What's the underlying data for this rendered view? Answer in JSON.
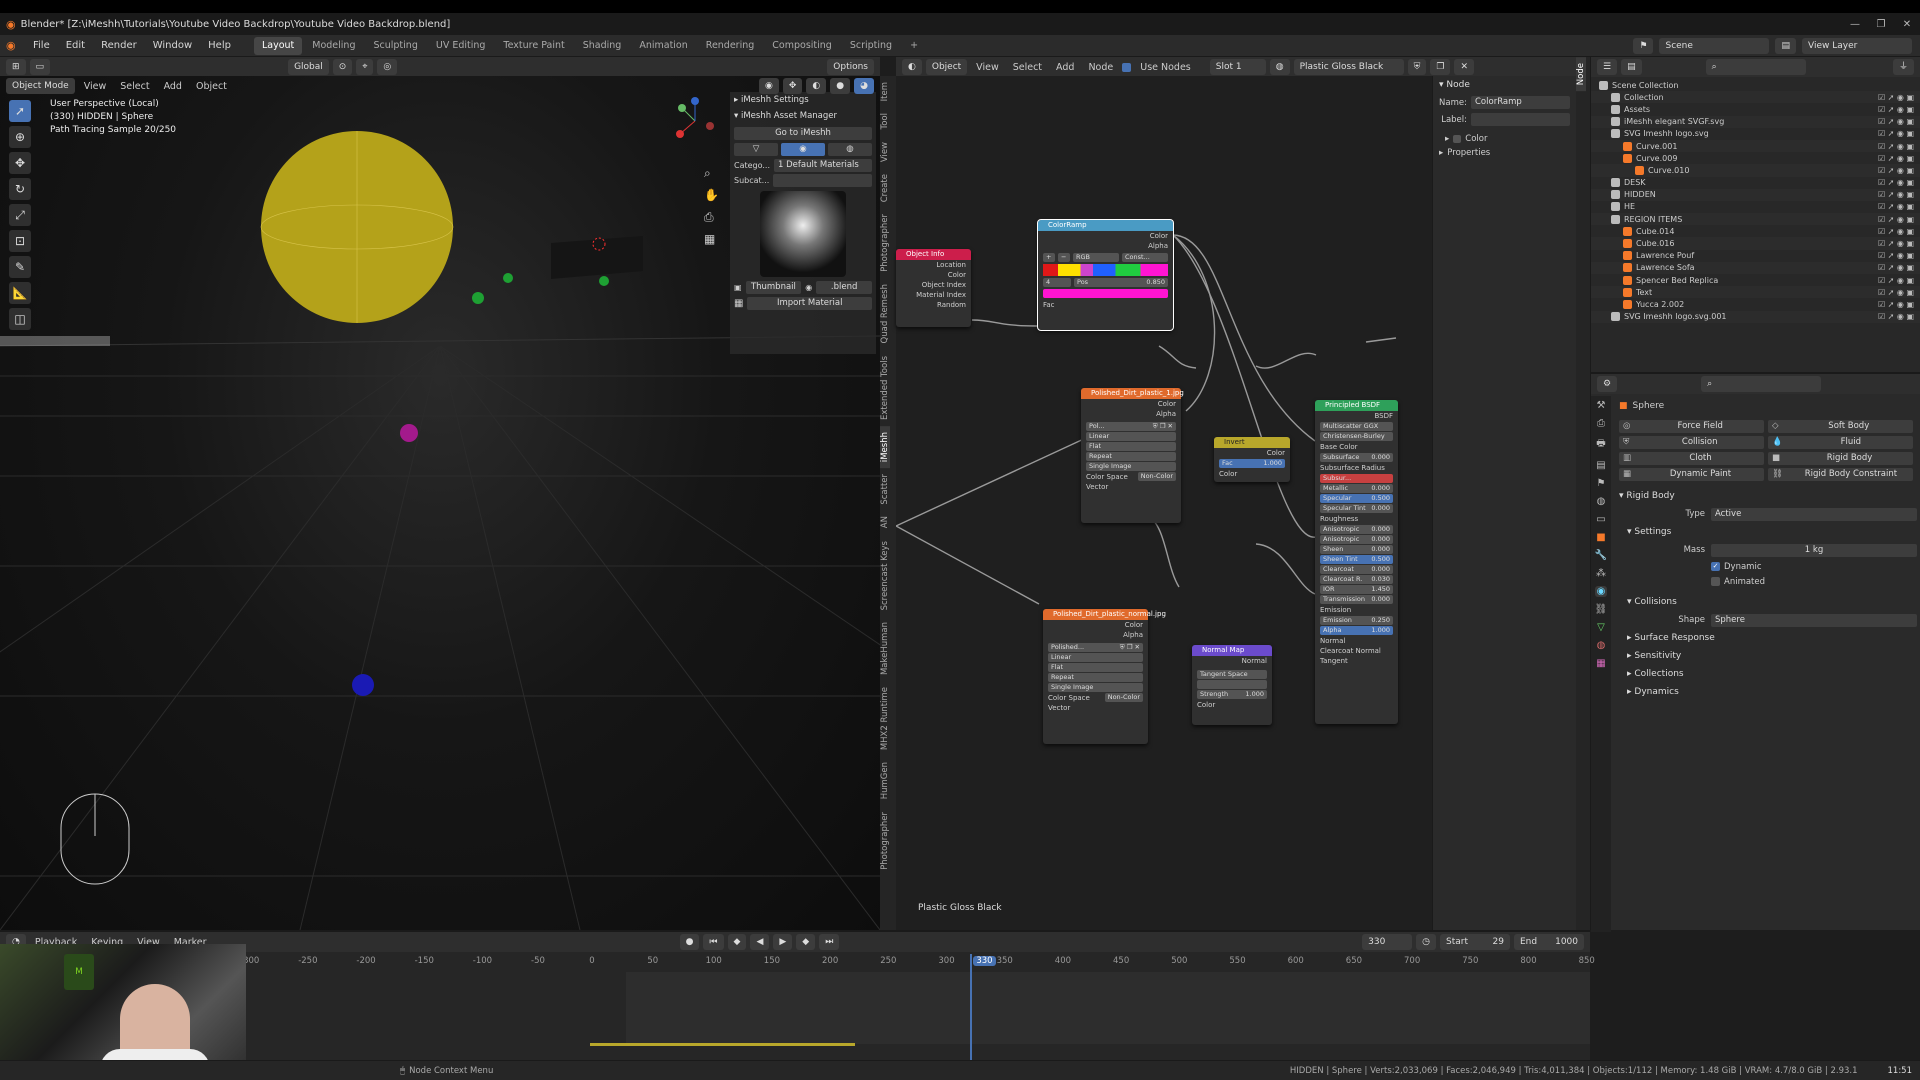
{
  "window": {
    "title": "Blender* [Z:\\iMeshh\\Tutorials\\Youtube Video Backdrop\\Youtube Video Backdrop.blend]"
  },
  "menu": [
    "File",
    "Edit",
    "Render",
    "Window",
    "Help"
  ],
  "workspaces": [
    "Layout",
    "Modeling",
    "Sculpting",
    "UV Editing",
    "Texture Paint",
    "Shading",
    "Animation",
    "Rendering",
    "Compositing",
    "Scripting"
  ],
  "viewport": {
    "mode": "Object Mode",
    "menu": [
      "View",
      "Select",
      "Add",
      "Object"
    ],
    "overlay_line1": "User Perspective (Local)",
    "overlay_line2": "(330) HIDDEN | Sphere",
    "overlay_line3": "Path Tracing Sample 20/250",
    "transform": "Global"
  },
  "imeshh": {
    "settings": "iMeshh Settings",
    "asset_manager": "iMeshh Asset Manager",
    "goto": "Go to iMeshh",
    "category_label": "Catego...",
    "category_value": "1 Default Materials",
    "subcat_label": "Subcat...",
    "thumbnail": "Thumbnail",
    "blend": ".blend",
    "import": "Import Material"
  },
  "viewport_tabs": [
    "Item",
    "Tool",
    "View",
    "Create",
    "Photographer",
    "Quad Remesh",
    "Extended Tools",
    "iMeshh",
    "Scatter",
    "AN",
    "Screencast Keys",
    "MakeHuman",
    "MHX2 Runtime",
    "HumGen",
    "Photographer"
  ],
  "node_editor": {
    "menu": [
      "View",
      "Select",
      "Add",
      "Node"
    ],
    "object_btn": "Object",
    "use_nodes": "Use Nodes",
    "slot": "Slot 1",
    "material": "Plastic Gloss Black",
    "footer_material": "Plastic Gloss Black",
    "options": "Options"
  },
  "nodes": {
    "objinfo": {
      "title": "Object Info",
      "rows": [
        "Location",
        "Color",
        "Object Index",
        "Material Index",
        "Random"
      ]
    },
    "colorramp": {
      "title": "ColorRamp",
      "out1": "Color",
      "out2": "Alpha",
      "mode": "RGB",
      "interp": "Const...",
      "idx": "4",
      "pos_label": "Pos",
      "pos": "0.850",
      "in": "Fac"
    },
    "tex1": {
      "title": "Polished_Dirt_plastic_1.jpg",
      "out1": "Color",
      "out2": "Alpha",
      "img": "Pol...",
      "opts": [
        "Linear",
        "Flat",
        "Repeat",
        "Single Image"
      ],
      "cs_label": "Color Space",
      "cs": "Non-Color",
      "vec": "Vector"
    },
    "invert": {
      "title": "Invert",
      "out": "Color",
      "fac_label": "Fac",
      "fac": "1.000",
      "in": "Color"
    },
    "tex2": {
      "title": "Polished_Dirt_plastic_normal.jpg",
      "out1": "Color",
      "out2": "Alpha",
      "img": "Polished...",
      "opts": [
        "Linear",
        "Flat",
        "Repeat",
        "Single Image"
      ],
      "cs_label": "Color Space",
      "cs": "Non-Color",
      "vec": "Vector"
    },
    "normalmap": {
      "title": "Normal Map",
      "out": "Normal",
      "space": "Tangent Space",
      "str_label": "Strength",
      "str": "1.000",
      "in": "Color"
    },
    "bsdf": {
      "title": "Principled BSDF",
      "out": "BSDF",
      "dist": "Multiscatter GGX",
      "sss": "Christensen-Burley",
      "rows": [
        [
          "Base Color",
          ""
        ],
        [
          "Subsurface",
          "0.000"
        ],
        [
          "Subsurface Radius",
          ""
        ],
        [
          "Subsur...",
          ""
        ],
        [
          "Metallic",
          "0.000"
        ],
        [
          "Specular",
          "0.500"
        ],
        [
          "Specular Tint",
          "0.000"
        ],
        [
          "Roughness",
          ""
        ],
        [
          "Anisotropic",
          "0.000"
        ],
        [
          "Anisotropic",
          "0.000"
        ],
        [
          "Sheen",
          "0.000"
        ],
        [
          "Sheen Tint",
          "0.500"
        ],
        [
          "Clearcoat",
          "0.000"
        ],
        [
          "Clearcoat R.",
          "0.030"
        ],
        [
          "IOR",
          "1.450"
        ],
        [
          "Transmission",
          "0.000"
        ],
        [
          "Emission",
          ""
        ],
        [
          "Emission",
          "0.250"
        ],
        [
          "Alpha",
          "1.000"
        ],
        [
          "Normal",
          ""
        ],
        [
          "Clearcoat Normal",
          ""
        ],
        [
          "Tangent",
          ""
        ]
      ]
    }
  },
  "npanel": {
    "tab": "Node",
    "name_label": "Name:",
    "name": "ColorRamp",
    "label_label": "Label:",
    "color": "Color",
    "properties": "Properties"
  },
  "outliner": {
    "scene": "Scene",
    "view_layer": "View Layer",
    "rows": [
      {
        "n": "Scene Collection",
        "d": 0
      },
      {
        "n": "Collection",
        "d": 1
      },
      {
        "n": "Assets",
        "d": 1
      },
      {
        "n": "iMeshh elegant SVGF.svg",
        "d": 1
      },
      {
        "n": "SVG Imeshh logo.svg",
        "d": 1
      },
      {
        "n": "Curve.001",
        "d": 2
      },
      {
        "n": "Curve.009",
        "d": 2
      },
      {
        "n": "Curve.010",
        "d": 3
      },
      {
        "n": "DESK",
        "d": 1
      },
      {
        "n": "HIDDEN",
        "d": 1
      },
      {
        "n": "HE",
        "d": 1
      },
      {
        "n": "REGION ITEMS",
        "d": 1
      },
      {
        "n": "Cube.014",
        "d": 2
      },
      {
        "n": "Cube.016",
        "d": 2
      },
      {
        "n": "Lawrence Pouf",
        "d": 2
      },
      {
        "n": "Lawrence Sofa",
        "d": 2
      },
      {
        "n": "Spencer Bed Replica",
        "d": 2
      },
      {
        "n": "Text",
        "d": 2
      },
      {
        "n": "Yucca 2.002",
        "d": 2
      },
      {
        "n": "SVG Imeshh logo.svg.001",
        "d": 1
      }
    ]
  },
  "properties": {
    "object": "Sphere",
    "phys_buttons": [
      "Force Field",
      "Soft Body",
      "Collision",
      "Fluid",
      "Cloth",
      "Rigid Body",
      "Dynamic Paint",
      "Rigid Body Constraint"
    ],
    "rigid_body": "Rigid Body",
    "type_label": "Type",
    "type": "Active",
    "settings": "Settings",
    "mass_label": "Mass",
    "mass": "1 kg",
    "dynamic": "Dynamic",
    "animated": "Animated",
    "collisions": "Collisions",
    "shape_label": "Shape",
    "shape": "Sphere",
    "subs": [
      "Surface Response",
      "Sensitivity",
      "Collections",
      "Dynamics"
    ]
  },
  "timeline": {
    "menu": [
      "Playback",
      "Keying",
      "View",
      "Marker"
    ],
    "current": "330",
    "start_label": "Start",
    "start": "29",
    "end_label": "End",
    "end": "1000",
    "ticks": [
      "-300",
      "-250",
      "-200",
      "-150",
      "-100",
      "-50",
      "0",
      "50",
      "100",
      "150",
      "200",
      "250",
      "300",
      "330",
      "350",
      "400",
      "450",
      "500",
      "550",
      "600",
      "650",
      "700",
      "750",
      "800",
      "850"
    ]
  },
  "status": {
    "left": "Node Context Menu",
    "right": "HIDDEN | Sphere | Verts:2,033,069 | Faces:2,046,949 | Tris:4,011,384 | Objects:1/112 | Memory: 1.48 GiB | VRAM: 4.7/8.0 GiB | 2.93.1"
  },
  "clock": "11:51",
  "colors": {
    "accent": "#4772b3",
    "sphere": "#b4a21a",
    "magenta": "#ff14d2"
  }
}
